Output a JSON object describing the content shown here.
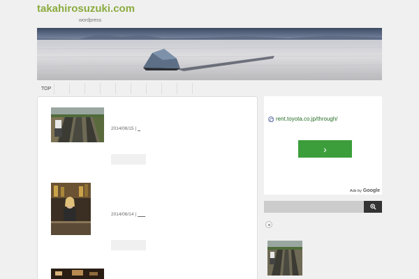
{
  "site": {
    "title": "takahirosuzuki.com",
    "tagline": "wordpress"
  },
  "banner": {
    "description_icon": "tent-on-salt-flat-photo"
  },
  "nav": {
    "items": [
      {
        "label": "TOP"
      },
      {
        "label": ""
      },
      {
        "label": ""
      },
      {
        "label": ""
      },
      {
        "label": ""
      },
      {
        "label": ""
      },
      {
        "label": ""
      },
      {
        "label": ""
      },
      {
        "label": ""
      },
      {
        "label": ""
      }
    ]
  },
  "posts": [
    {
      "date": "2014/06/15",
      "separator": "|",
      "title": "_",
      "thumb_icon": "garden-rows-photo"
    },
    {
      "date": "2014/06/14",
      "separator": "|",
      "title": "___",
      "thumb_icon": "bar-interior-photo"
    },
    {
      "date": "",
      "separator": "",
      "title": "",
      "thumb_icon": "room-interior-photo"
    }
  ],
  "ad": {
    "link_text": "rent.toyota.co.jp/through/",
    "cta_glyph": "›",
    "ads_by": "Ads by",
    "google": "Google"
  },
  "search": {
    "placeholder": "",
    "button_icon": "magnifier-icon"
  },
  "sidebar": {
    "recent_thumb_icon": "garden-rows-photo"
  },
  "colors": {
    "title_green": "#8aac3f",
    "ad_green": "#3b9e3b",
    "ad_link_green": "#236b23",
    "background": "#f0f0f0"
  }
}
